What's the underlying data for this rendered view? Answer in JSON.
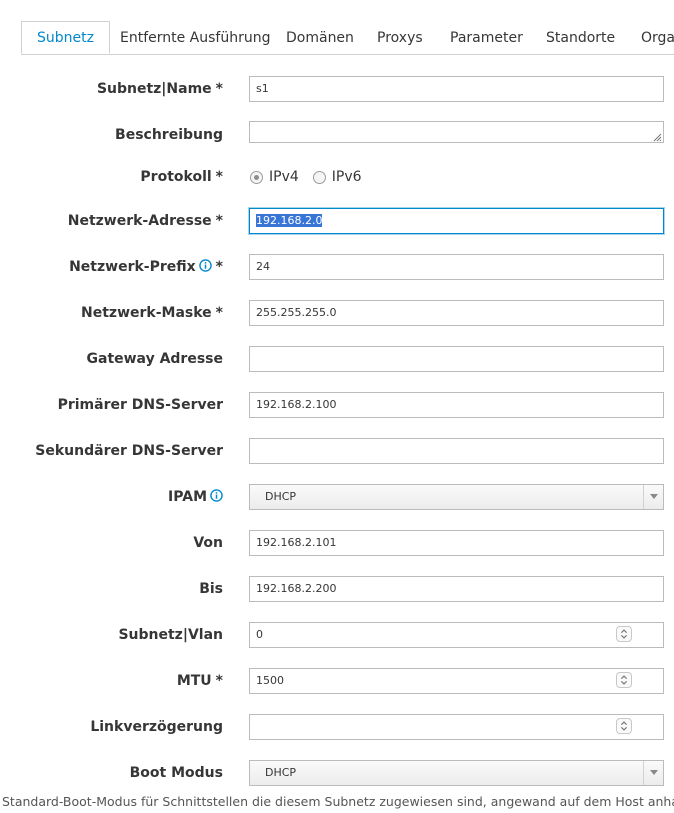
{
  "tabs": [
    {
      "label": "Subnetz",
      "active": true
    },
    {
      "label": "Entfernte Ausführung"
    },
    {
      "label": "Domänen"
    },
    {
      "label": "Proxys"
    },
    {
      "label": "Parameter"
    },
    {
      "label": "Standorte"
    },
    {
      "label": "Orga"
    }
  ],
  "form": {
    "name": {
      "label": "Subnetz|Name",
      "required": "*",
      "value": "s1"
    },
    "description": {
      "label": "Beschreibung",
      "value": ""
    },
    "protocol": {
      "label": "Protokoll",
      "required": "*",
      "options": [
        "IPv4",
        "IPv6"
      ],
      "selected": "IPv4"
    },
    "network_address": {
      "label": "Netzwerk-Adresse",
      "required": "*",
      "value": "192.168.2.0"
    },
    "network_prefix": {
      "label": "Netzwerk-Prefix",
      "required": "*",
      "value": "24"
    },
    "network_mask": {
      "label": "Netzwerk-Maske",
      "required": "*",
      "value": "255.255.255.0"
    },
    "gateway": {
      "label": "Gateway Adresse",
      "value": ""
    },
    "primary_dns": {
      "label": "Primärer DNS-Server",
      "value": "192.168.2.100"
    },
    "secondary_dns": {
      "label": "Sekundärer DNS-Server",
      "value": ""
    },
    "ipam": {
      "label": "IPAM",
      "value": "DHCP"
    },
    "from": {
      "label": "Von",
      "value": "192.168.2.101"
    },
    "to": {
      "label": "Bis",
      "value": "192.168.2.200"
    },
    "vlan": {
      "label": "Subnetz|Vlan",
      "value": "0"
    },
    "mtu": {
      "label": "MTU",
      "required": "*",
      "value": "1500"
    },
    "link_delay": {
      "label": "Linkverzögerung",
      "value": ""
    },
    "boot_mode": {
      "label": "Boot Modus",
      "value": "DHCP"
    }
  },
  "help_text": "Standard-Boot-Modus für Schnittstellen die diesem Subnetz zugewiesen sind, angewand auf dem Host anha",
  "colors": {
    "accent": "#0088ce",
    "selection": "#3875d7",
    "border": "#bbbbbb"
  },
  "icons": [
    "info-icon",
    "caret-down-icon",
    "spinner-arrows-icon",
    "resize-grip-icon"
  ]
}
